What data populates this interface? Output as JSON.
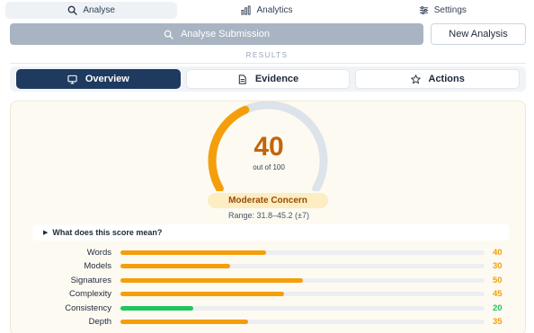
{
  "nav": {
    "tabs": [
      {
        "label": "Analyse",
        "icon": "search-icon",
        "active": true
      },
      {
        "label": "Analytics",
        "icon": "bar-chart-icon",
        "active": false
      },
      {
        "label": "Settings",
        "icon": "sliders-icon",
        "active": false
      }
    ]
  },
  "actions": {
    "analyse_label": "Analyse Submission",
    "new_label": "New Analysis"
  },
  "results_label": "RESULTS",
  "view_tabs": [
    {
      "label": "Overview",
      "icon": "monitor-icon",
      "active": true
    },
    {
      "label": "Evidence",
      "icon": "document-icon",
      "active": false
    },
    {
      "label": "Actions",
      "icon": "star-icon",
      "active": false
    }
  ],
  "score": {
    "value": "40",
    "out_of": "out of 100",
    "level": 0.4,
    "badge": "Moderate Concern",
    "range": "Range: 31.8–45.2 (±7)"
  },
  "explain_label": "What does this score mean?",
  "metrics": [
    {
      "label": "Words",
      "value": 40,
      "display": "40",
      "color": "#f59e0b"
    },
    {
      "label": "Models",
      "value": 30,
      "display": "30",
      "color": "#f59e0b"
    },
    {
      "label": "Signatures",
      "value": 50,
      "display": "50",
      "color": "#f59e0b"
    },
    {
      "label": "Complexity",
      "value": 45,
      "display": "45",
      "color": "#f59e0b"
    },
    {
      "label": "Consistency",
      "value": 20,
      "display": "20",
      "color": "#22c55e"
    },
    {
      "label": "Depth",
      "value": 35,
      "display": "35",
      "color": "#f59e0b"
    }
  ],
  "colors": {
    "accent_orange": "#f59e0b",
    "score_text": "#c2660a",
    "nav_dark": "#1f3a5f",
    "green": "#22c55e"
  }
}
